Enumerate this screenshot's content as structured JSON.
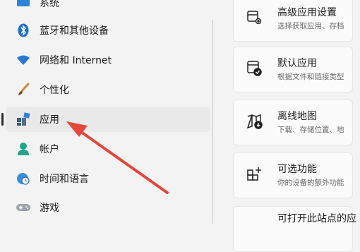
{
  "sidebar": {
    "items": [
      {
        "label": "系统",
        "icon": "system-icon"
      },
      {
        "label": "蓝牙和其他设备",
        "icon": "bluetooth-icon"
      },
      {
        "label": "网络和 Internet",
        "icon": "wifi-icon"
      },
      {
        "label": "个性化",
        "icon": "brush-icon"
      },
      {
        "label": "应用",
        "icon": "apps-icon",
        "selected": true
      },
      {
        "label": "帐户",
        "icon": "account-icon"
      },
      {
        "label": "时间和语言",
        "icon": "globe-clock-icon"
      },
      {
        "label": "游戏",
        "icon": "gamepad-icon"
      }
    ]
  },
  "main": {
    "cards": [
      {
        "title": "高级应用设置",
        "subtitle": "选择获取应用、存档",
        "icon": "advanced-app-settings-icon"
      },
      {
        "title": "默认应用",
        "subtitle": "根据文件和链接类型",
        "icon": "default-apps-icon"
      },
      {
        "title": "离线地图",
        "subtitle": "下载、存储位置、地",
        "icon": "offline-maps-icon"
      },
      {
        "title": "可选功能",
        "subtitle": "你的设备的额外功能",
        "icon": "optional-features-icon"
      },
      {
        "title": "可打开此站点的应",
        "subtitle": "",
        "icon": "apps-for-websites-icon"
      }
    ]
  },
  "annotation": {
    "color": "#e4473c"
  }
}
